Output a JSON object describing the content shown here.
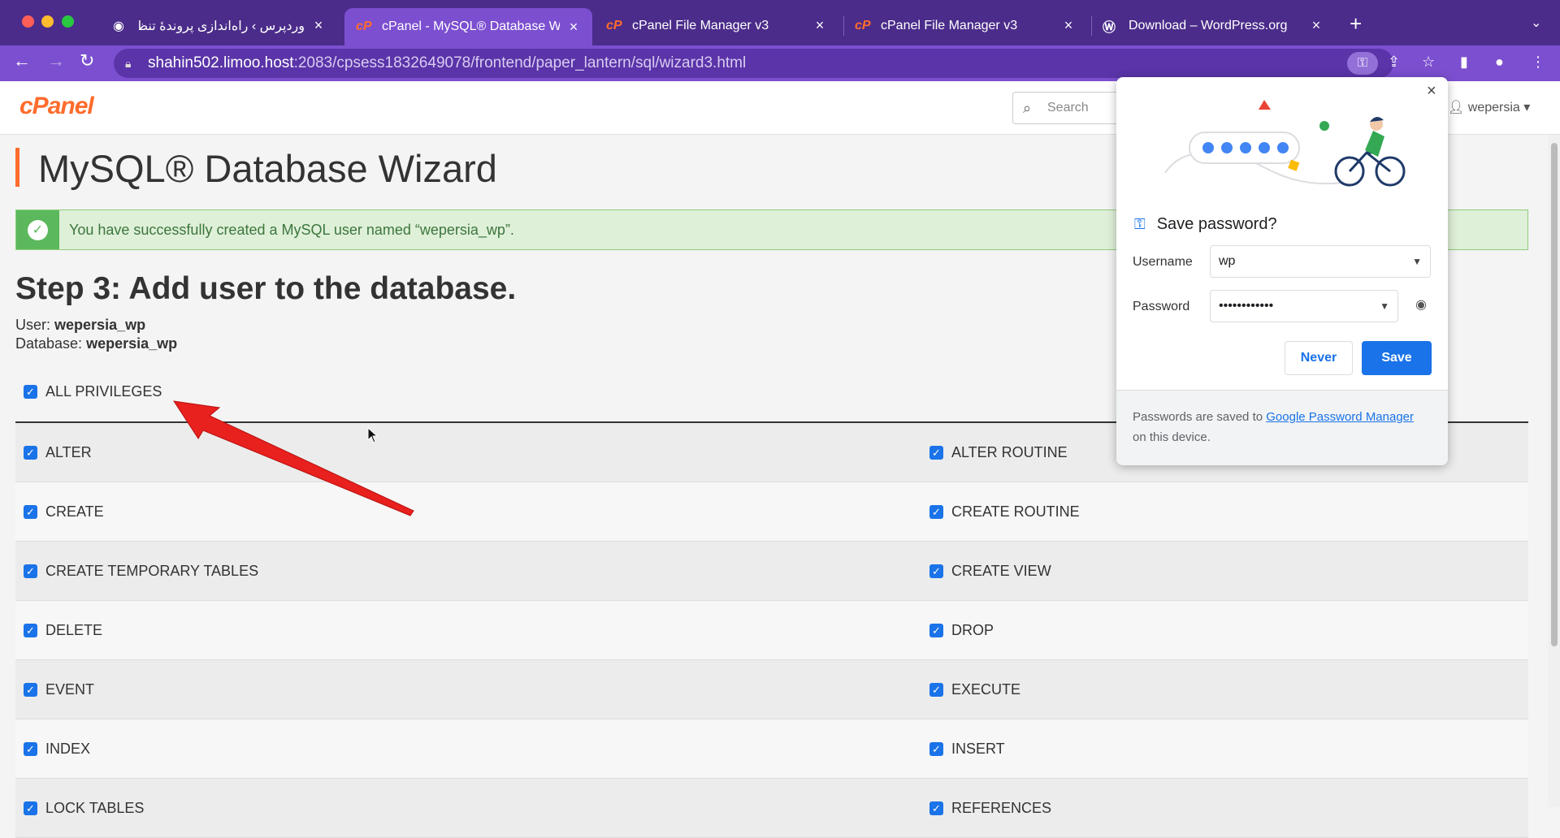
{
  "browser": {
    "tabs": [
      {
        "title": "وردپرس › راه‌اندازی پروندهٔ تنظیمات",
        "icon": "globe-icon"
      },
      {
        "title": "cPanel - MySQL® Database Wi",
        "icon": "cpanel-icon",
        "active": true
      },
      {
        "title": "cPanel File Manager v3",
        "icon": "cpanel-icon"
      },
      {
        "title": "cPanel File Manager v3",
        "icon": "cpanel-icon"
      },
      {
        "title": "Download – WordPress.org",
        "icon": "wordpress-icon"
      }
    ],
    "close_glyph": "×",
    "url_host": "shahin502.limoo.host",
    "url_path": ":2083/cpsess1832649078/frontend/paper_lantern/sql/wizard3.html"
  },
  "cpanel": {
    "logo": "cPanel",
    "search_placeholder": "Search",
    "username": "wepersia"
  },
  "page": {
    "title": "MySQL® Database Wizard",
    "alert": "You have successfully created a MySQL user named “wepersia_wp”.",
    "step_title": "Step 3: Add user to the database.",
    "user_label": "User:",
    "user_value": "wepersia_wp",
    "db_label": "Database:",
    "db_value": "wepersia_wp",
    "all_privileges": "ALL PRIVILEGES",
    "privileges": [
      [
        "ALTER",
        "ALTER ROUTINE"
      ],
      [
        "CREATE",
        "CREATE ROUTINE"
      ],
      [
        "CREATE TEMPORARY TABLES",
        "CREATE VIEW"
      ],
      [
        "DELETE",
        "DROP"
      ],
      [
        "EVENT",
        "EXECUTE"
      ],
      [
        "INDEX",
        "INSERT"
      ],
      [
        "LOCK TABLES",
        "REFERENCES"
      ]
    ]
  },
  "password_popup": {
    "title": "Save password?",
    "username_label": "Username",
    "username_value": "wp",
    "password_label": "Password",
    "password_value": "••••••••••••",
    "never_label": "Never",
    "save_label": "Save",
    "footer_prefix": "Passwords are saved to ",
    "footer_link": "Google Password Manager",
    "footer_suffix": "on this device."
  },
  "colors": {
    "tabbar": "#4b2c8a",
    "addressbar": "#7c4fd0",
    "cpanel_orange": "#ff6c2c",
    "success_green": "#5cb85c",
    "google_blue": "#1a73e8"
  }
}
